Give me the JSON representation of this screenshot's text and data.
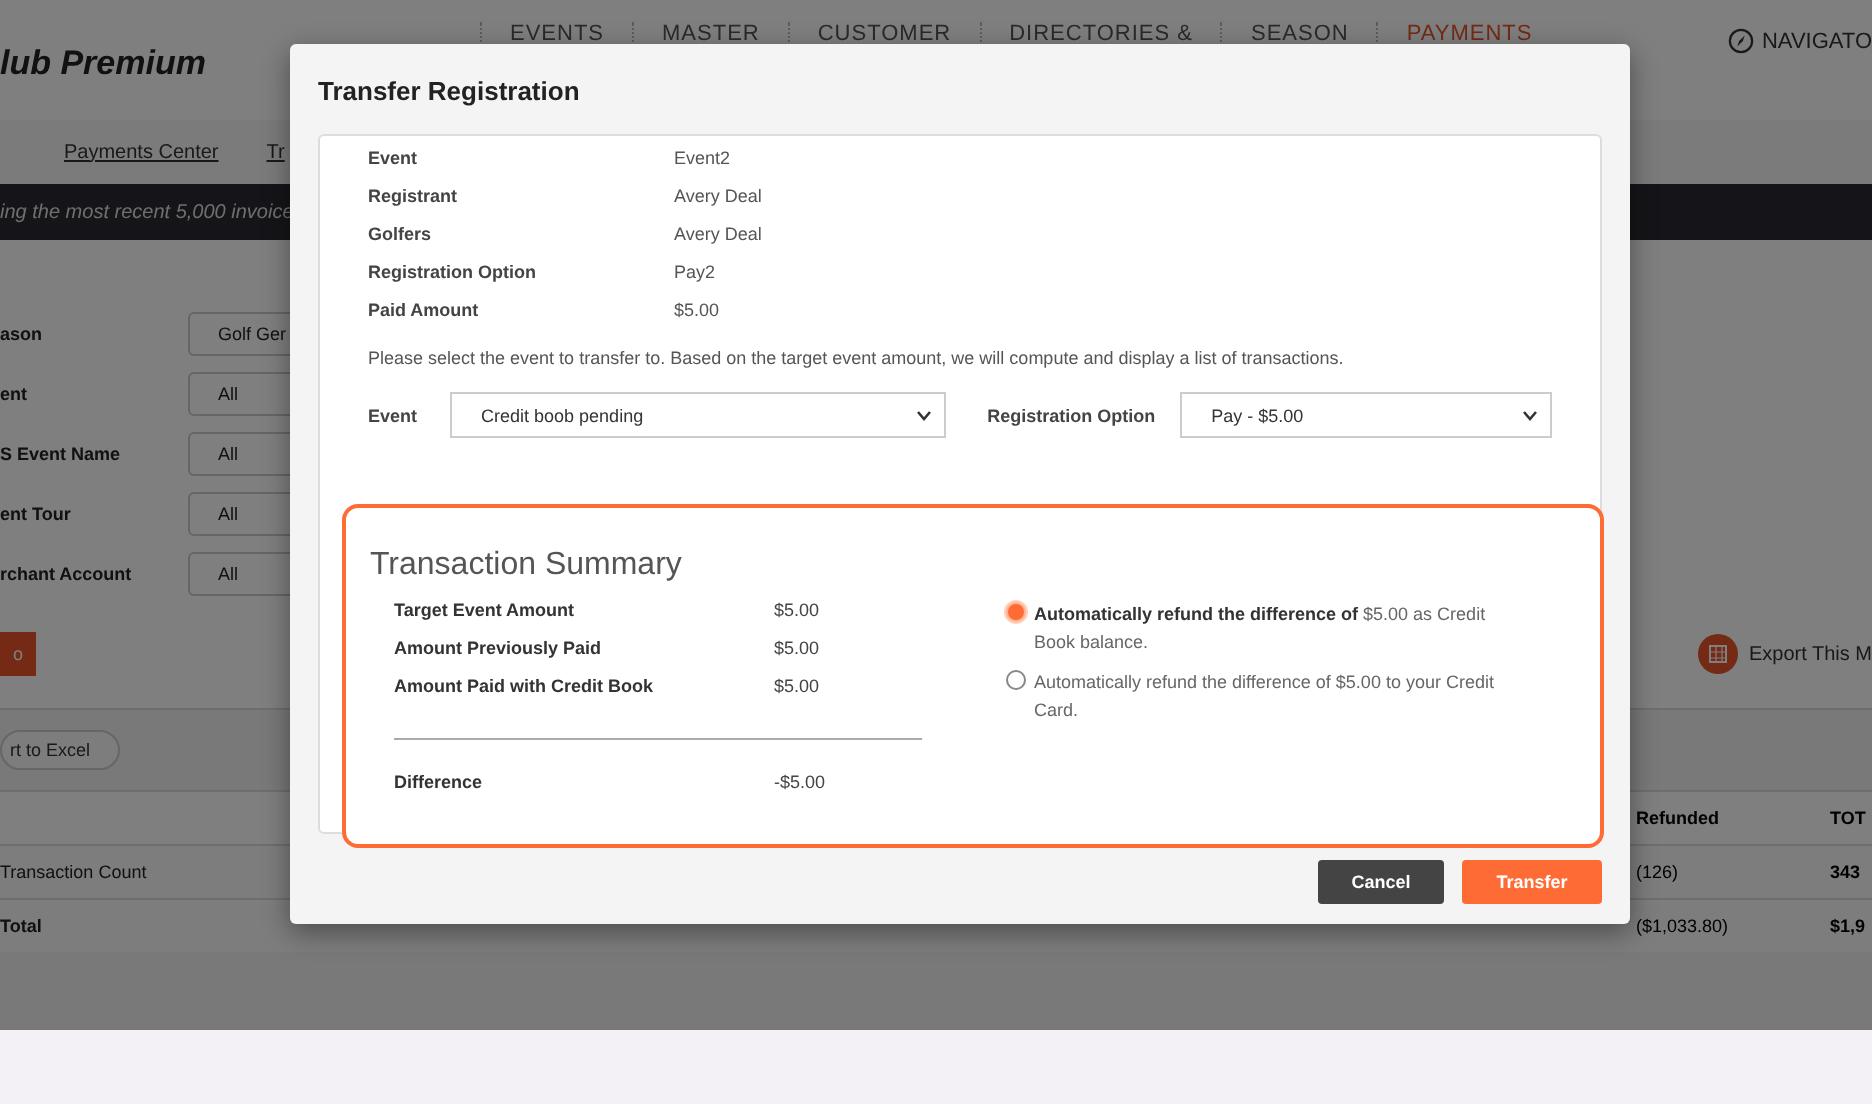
{
  "app": {
    "brand": "lub Premium",
    "nav": [
      {
        "label": "EVENTS",
        "selected": false
      },
      {
        "label": "MASTER",
        "selected": false
      },
      {
        "label": "CUSTOMER",
        "selected": false
      },
      {
        "label": "DIRECTORIES &",
        "selected": false
      },
      {
        "label": "SEASON",
        "selected": false
      },
      {
        "label": "PAYMENTS",
        "selected": true
      }
    ],
    "navigator": "NAVIGATO"
  },
  "breadcrumb": [
    "Payments Center",
    "Tr"
  ],
  "banner": "ing the most recent 5,000 invoice",
  "filters": [
    {
      "label": "ason",
      "value": "Golf Ger"
    },
    {
      "label": "ent",
      "value": "All"
    },
    {
      "label": "S Event Name",
      "value": "All"
    },
    {
      "label": "ent Tour",
      "value": "All"
    },
    {
      "label": "rchant Account",
      "value": "All"
    }
  ],
  "go_button": "o",
  "export_excel": "rt to Excel",
  "export_this": "Export This M",
  "table": {
    "columns": [
      "Refunded",
      "TOT"
    ],
    "rows": [
      {
        "label": "Transaction Count",
        "cells": [
          "(126)",
          "343"
        ]
      },
      {
        "label": "Total",
        "cells": [
          "($1,033.80)",
          "$1,9"
        ]
      }
    ]
  },
  "dialog": {
    "title": "Transfer Registration",
    "details": [
      {
        "label": "Event",
        "value": "Event2"
      },
      {
        "label": "Registrant",
        "value": "Avery Deal"
      },
      {
        "label": "Golfers",
        "value": "Avery Deal"
      },
      {
        "label": "Registration Option",
        "value": "Pay2"
      },
      {
        "label": "Paid Amount",
        "value": "$5.00"
      }
    ],
    "instruction": "Please select the event to transfer to. Based on the target event amount, we will compute and display a list of transactions.",
    "event_select": {
      "label": "Event",
      "value": "Credit boob pending"
    },
    "option_select": {
      "label": "Registration Option",
      "value": "Pay - $5.00"
    },
    "summary": {
      "title": "Transaction Summary",
      "rows": [
        {
          "label": "Target Event Amount",
          "value": "$5.00"
        },
        {
          "label": "Amount Previously Paid",
          "value": "$5.00"
        },
        {
          "label": "Amount Paid with Credit Book",
          "value": "$5.00"
        }
      ],
      "difference": {
        "label": "Difference",
        "value": "-$5.00"
      },
      "options": [
        {
          "text": "**Automatically refund the difference of** $5.00 as Credit Book balance.",
          "selected": true
        },
        {
          "text": "Automatically refund the difference of $5.00 to your Credit Card.",
          "selected": false
        }
      ]
    },
    "buttons": [
      {
        "label": "Cancel",
        "kind": "secondary"
      },
      {
        "label": "Transfer",
        "kind": "primary"
      }
    ]
  }
}
